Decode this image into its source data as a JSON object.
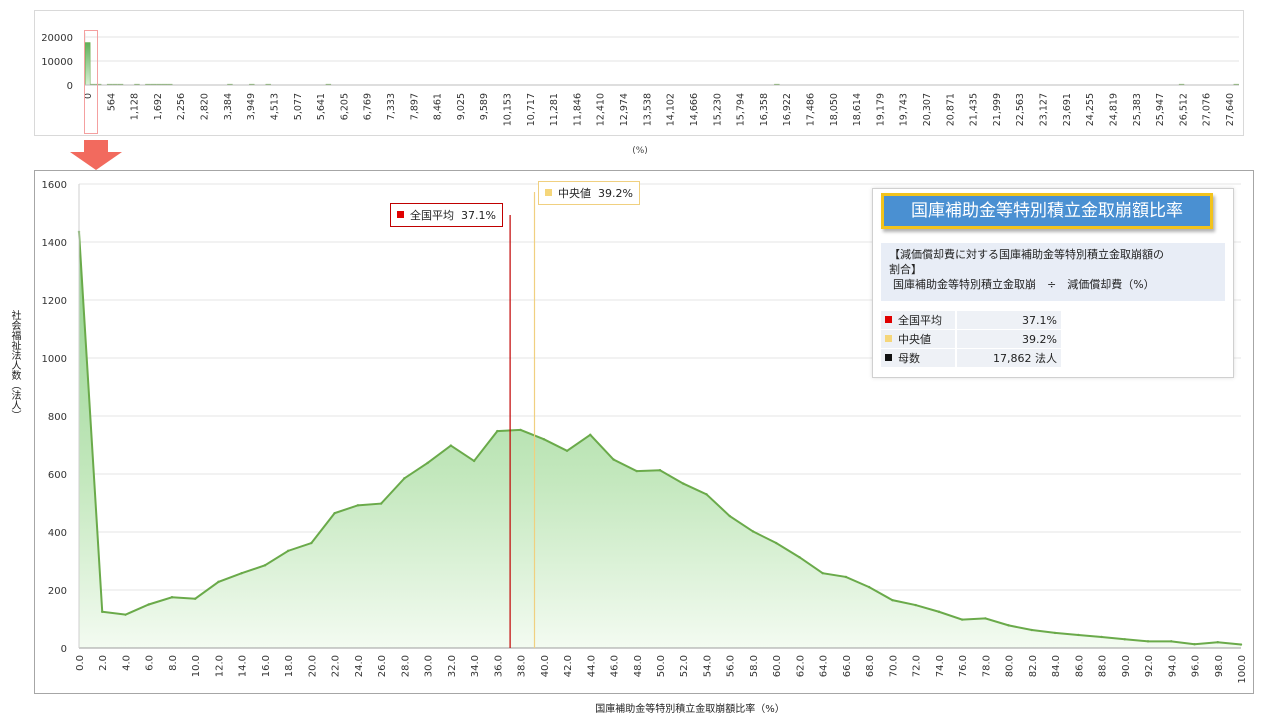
{
  "chart_data": [
    {
      "type": "bar",
      "yticks": [
        "20000",
        "10000",
        "0"
      ],
      "ylim": [
        0,
        20000
      ],
      "x_tick_labels": [
        "0",
        "564",
        "1,128",
        "1,692",
        "2,256",
        "2,820",
        "3,384",
        "3,949",
        "4,513",
        "5,077",
        "5,641",
        "6,205",
        "6,769",
        "7,333",
        "7,897",
        "8,461",
        "9,025",
        "9,589",
        "10,153",
        "10,717",
        "11,281",
        "11,846",
        "12,410",
        "12,974",
        "13,538",
        "14,102",
        "14,666",
        "15,230",
        "15,794",
        "16,358",
        "16,922",
        "17,486",
        "18,050",
        "18,614",
        "19,179",
        "19,743",
        "20,307",
        "20,871",
        "21,435",
        "21,999",
        "22,563",
        "23,127",
        "23,691",
        "24,255",
        "24,819",
        "25,383",
        "25,947",
        "26,512",
        "27,076",
        "27,640"
      ],
      "bin_values": [
        17700,
        350,
        350,
        0,
        350,
        350,
        350,
        0,
        0,
        350,
        0,
        350,
        350,
        350,
        350,
        350,
        0,
        0,
        0,
        0,
        0,
        0,
        0,
        0,
        0,
        0,
        350,
        0,
        0,
        0,
        350,
        0,
        0,
        350,
        0,
        0,
        0,
        0,
        0,
        0,
        0,
        0,
        0,
        0,
        350,
        0,
        0,
        0,
        0,
        0,
        0,
        0,
        0,
        0,
        0,
        0,
        0,
        0,
        0,
        0,
        0,
        0,
        0,
        0,
        0,
        0,
        0,
        0,
        0,
        0,
        0,
        0,
        0,
        0,
        0,
        0,
        0,
        0,
        0,
        0,
        0,
        0,
        0,
        0,
        0,
        0,
        0,
        0,
        0,
        0,
        0,
        0,
        0,
        0,
        0,
        0,
        0,
        0,
        0,
        0,
        0,
        0,
        0,
        0,
        0,
        0,
        0,
        0,
        0,
        0,
        0,
        0,
        0,
        0,
        0,
        0,
        0,
        0,
        0,
        0,
        0,
        0,
        0,
        0,
        0,
        0,
        350,
        0,
        0,
        0,
        0,
        0,
        0,
        0,
        0,
        0,
        0,
        0,
        0,
        0,
        0,
        0,
        0,
        0,
        0,
        0,
        0,
        0,
        0,
        0,
        0,
        0,
        0,
        0,
        0,
        0,
        0,
        0,
        0,
        0,
        0,
        0,
        0,
        0,
        0,
        0,
        0,
        0,
        0,
        0,
        0,
        0,
        0,
        0,
        0,
        0,
        0,
        0,
        0,
        0,
        0,
        0,
        0,
        0,
        0,
        0,
        0,
        0,
        0,
        0,
        0,
        0,
        0,
        0,
        0,
        0,
        0,
        0,
        0,
        0,
        350,
        0,
        0,
        0,
        0,
        0,
        0,
        0,
        0,
        0,
        350
      ],
      "xlabel": "(%)",
      "grid": true
    },
    {
      "type": "area",
      "x": [
        0,
        2,
        4,
        6,
        8,
        10,
        12,
        14,
        16,
        18,
        20,
        22,
        24,
        26,
        28,
        30,
        32,
        34,
        36,
        38,
        40,
        42,
        44,
        46,
        48,
        50,
        52,
        54,
        56,
        58,
        60,
        62,
        64,
        66,
        68,
        70,
        72,
        74,
        76,
        78,
        80,
        82,
        84,
        86,
        88,
        90,
        92,
        94,
        96,
        98,
        100
      ],
      "values": [
        1435,
        125,
        115,
        150,
        175,
        170,
        228,
        258,
        285,
        335,
        362,
        465,
        492,
        498,
        585,
        638,
        698,
        645,
        748,
        752,
        720,
        680,
        735,
        650,
        610,
        613,
        567,
        530,
        455,
        402,
        362,
        313,
        258,
        245,
        210,
        165,
        148,
        125,
        98,
        102,
        78,
        62,
        52,
        45,
        38,
        30,
        23,
        23,
        13,
        20,
        12
      ],
      "x_tick_labels": [
        "0.0",
        "2.0",
        "4.0",
        "6.0",
        "8.0",
        "10.0",
        "12.0",
        "14.0",
        "16.0",
        "18.0",
        "20.0",
        "22.0",
        "24.0",
        "26.0",
        "28.0",
        "30.0",
        "32.0",
        "34.0",
        "36.0",
        "38.0",
        "40.0",
        "42.0",
        "44.0",
        "46.0",
        "48.0",
        "50.0",
        "52.0",
        "54.0",
        "56.0",
        "58.0",
        "60.0",
        "62.0",
        "64.0",
        "66.0",
        "68.0",
        "70.0",
        "72.0",
        "74.0",
        "76.0",
        "78.0",
        "80.0",
        "82.0",
        "84.0",
        "86.0",
        "88.0",
        "90.0",
        "92.0",
        "94.0",
        "96.0",
        "98.0",
        "100.0"
      ],
      "yticks": [
        "1600",
        "1400",
        "1200",
        "1000",
        "800",
        "600",
        "400",
        "200",
        "0"
      ],
      "ylim": [
        0,
        1600
      ],
      "xlim": [
        0,
        100
      ],
      "xlabel": "国庫補助金等特別積立金取崩額比率（%）",
      "ylabel": "社会福祉法人数（法人）",
      "grid": true,
      "reference_lines": [
        {
          "label": "全国平均",
          "value_text": "37.1%",
          "x": 37.1,
          "color": "#c00000"
        },
        {
          "label": "中央値",
          "value_text": "39.2%",
          "x": 39.2,
          "color": "#f0d080"
        }
      ]
    }
  ],
  "info_box": {
    "title": "国庫補助金等特別積立金取崩額比率",
    "definition_line1": "【減価償却費に対する国庫補助金等特別積立金取崩額の",
    "definition_line2": "割合】",
    "definition_line3": "国庫補助金等特別積立金取崩　÷　減価償却費（%）",
    "stats": [
      {
        "name": "全国平均",
        "value": "37.1%",
        "color": "#e00000"
      },
      {
        "name": "中央値",
        "value": "39.2%",
        "color": "#f5d67a"
      },
      {
        "name": "母数",
        "value": "17,862  法人",
        "color": "#111111"
      }
    ]
  },
  "colors": {
    "area_line": "#6aaa4a",
    "area_fill_top": "#8fd18a",
    "area_fill_bottom": "#f3fbf1",
    "highlight_arrow": "#f26a5e"
  }
}
